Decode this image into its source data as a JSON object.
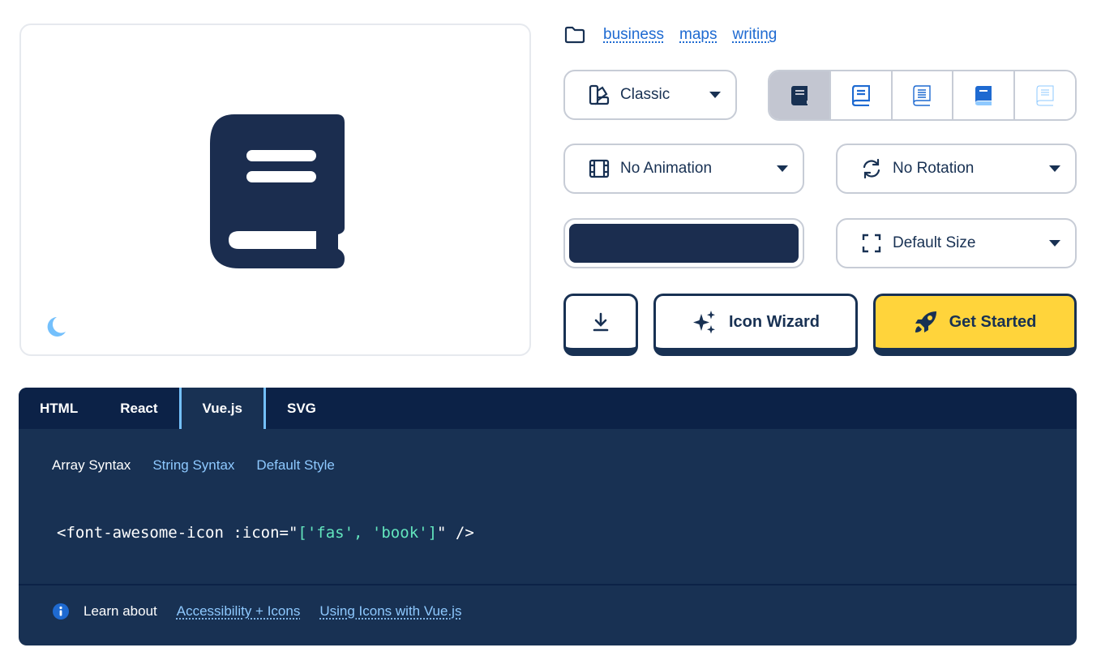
{
  "preview": {
    "icon": "book-icon",
    "theme_toggle_icon": "moon-icon"
  },
  "categories": {
    "icon": "folder-icon",
    "items": [
      "business",
      "maps",
      "writing"
    ]
  },
  "style_select": {
    "label": "Classic",
    "icon": "swatchbook-icon"
  },
  "style_variants": [
    "book-solid",
    "book-regular",
    "book-light",
    "book-duotone",
    "book-thin"
  ],
  "animation_select": {
    "label": "No Animation",
    "icon": "film-icon"
  },
  "rotation_select": {
    "label": "No Rotation",
    "icon": "arrows-rotate-icon"
  },
  "color": {
    "value": "#1b2d4f"
  },
  "size_select": {
    "label": "Default Size",
    "icon": "expand-icon"
  },
  "actions": {
    "download_icon": "download-icon",
    "wizard_label": "Icon Wizard",
    "wizard_icon": "sparkles-icon",
    "start_label": "Get Started",
    "start_icon": "rocket-icon"
  },
  "code_panel": {
    "tabs": [
      "HTML",
      "React",
      "Vue.js",
      "SVG"
    ],
    "active_tab": "Vue.js",
    "subtabs": [
      "Array Syntax",
      "String Syntax",
      "Default Style"
    ],
    "active_subtab": "Array Syntax",
    "code": {
      "prefix": "<font-awesome-icon :icon=\"",
      "value": "['fas', 'book']",
      "suffix": "\" />"
    },
    "learn_label": "Learn about",
    "links": [
      "Accessibility + Icons",
      "Using Icons with Vue.js"
    ]
  },
  "colors": {
    "navy": "#183153",
    "dark_navy": "#0c2247",
    "accent_blue": "#1e6ad1",
    "light_blue": "#74c0fc",
    "yellow": "#ffd43b",
    "code_string": "#63e6be"
  }
}
